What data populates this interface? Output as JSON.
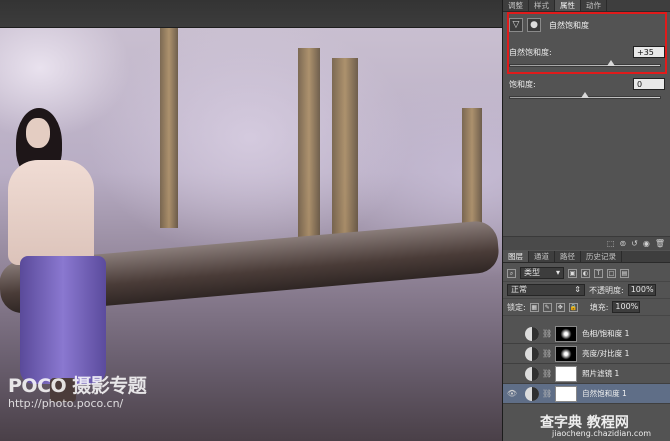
{
  "top_panel": {
    "tabs": [
      "调整",
      "样式",
      "属性",
      "动作"
    ],
    "active_tab": "属性"
  },
  "properties": {
    "title": "自然饱和度",
    "vibrance_label": "自然饱和度:",
    "vibrance_value": "+35",
    "saturation_label": "饱和度:",
    "saturation_value": "0"
  },
  "layers_panel": {
    "tabs": [
      "图层",
      "通道",
      "路径",
      "历史记录"
    ],
    "active_tab": "图层",
    "filter_label": "类型",
    "blend_mode": "正常",
    "opacity_label": "不透明度:",
    "opacity_value": "100%",
    "lock_label": "锁定:",
    "fill_label": "填充:",
    "fill_value": "100%",
    "layers": [
      {
        "name": "色相/饱和度 1",
        "mask": "black",
        "selected": false
      },
      {
        "name": "亮度/对比度 1",
        "mask": "black",
        "selected": false
      },
      {
        "name": "照片滤镜 1",
        "mask": "white",
        "selected": false
      },
      {
        "name": "自然饱和度 1",
        "mask": "white",
        "selected": true
      }
    ]
  },
  "watermark": {
    "logo": "POCO 摄影专题",
    "url": "http://photo.poco.cn/"
  },
  "site_watermark": {
    "text": "查字典 教程网",
    "url": "jiaocheng.chazidian.com"
  },
  "colors": {
    "highlight_frame": "#e01b1b",
    "selected_layer": "#5f6e87",
    "panel_bg": "#535353"
  }
}
